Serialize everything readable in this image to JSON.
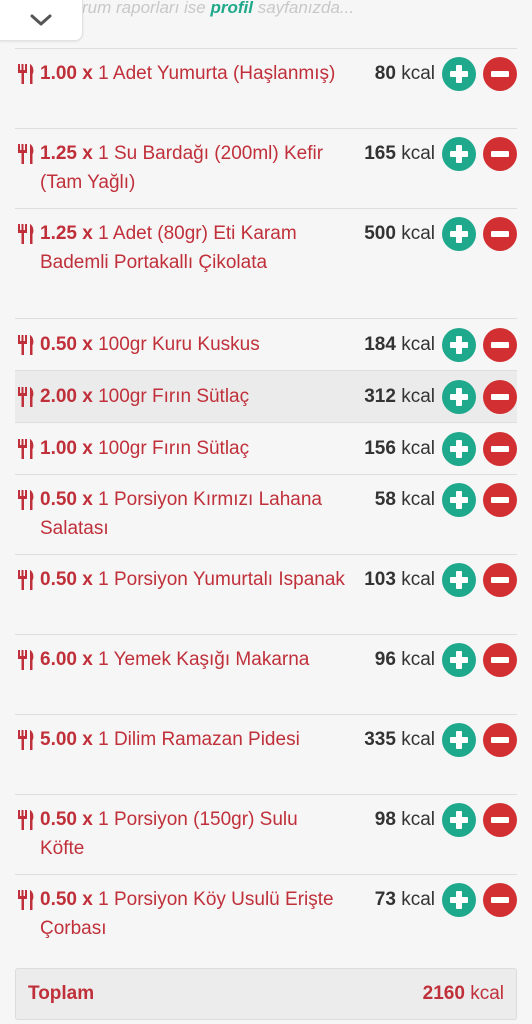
{
  "header": {
    "hint_prefix": "rum raporları ise ",
    "hint_link": "profil",
    "hint_suffix": " sayfanızda...",
    "toggle_icon": "chevron-down-icon"
  },
  "colors": {
    "accent_red": "#c0303a",
    "plus_green": "#1ea88c",
    "minus_red": "#d22f33"
  },
  "kcal_unit": "kcal",
  "items": [
    {
      "qty": "1.00 x",
      "food": "1 Adet Yumurta (Haşlanmış)",
      "kcal": "80",
      "lines": 2
    },
    {
      "qty": "1.25 x",
      "food": "1 Su Bardağı (200ml) Kefir (Tam Yağlı)",
      "kcal": "165",
      "lines": 2
    },
    {
      "qty": "1.25 x",
      "food": "1 Adet (80gr) Eti Karam Bademli Portakallı Çikolata",
      "kcal": "500",
      "lines": 3
    },
    {
      "qty": "0.50 x",
      "food": "100gr Kuru Kuskus",
      "kcal": "184",
      "lines": 1
    },
    {
      "qty": "2.00 x",
      "food": "100gr Fırın Sütlaç",
      "kcal": "312",
      "lines": 1,
      "highlighted": true
    },
    {
      "qty": "1.00 x",
      "food": "100gr Fırın Sütlaç",
      "kcal": "156",
      "lines": 1
    },
    {
      "qty": "0.50 x",
      "food": "1 Porsiyon Kırmızı Lahana Salatası",
      "kcal": "58",
      "lines": 2
    },
    {
      "qty": "0.50 x",
      "food": "1 Porsiyon Yumurtalı Ispanak",
      "kcal": "103",
      "lines": 2
    },
    {
      "qty": "6.00 x",
      "food": "1 Yemek Kaşığı Makarna",
      "kcal": "96",
      "lines": 2
    },
    {
      "qty": "5.00 x",
      "food": "1 Dilim Ramazan Pidesi",
      "kcal": "335",
      "lines": 2
    },
    {
      "qty": "0.50 x",
      "food": "1 Porsiyon (150gr) Sulu Köfte",
      "kcal": "98",
      "lines": 2
    },
    {
      "qty": "0.50 x",
      "food": "1 Porsiyon Köy Usulü Erişte Çorbası",
      "kcal": "73",
      "lines": 2
    }
  ],
  "total": {
    "label": "Toplam",
    "value": "2160",
    "unit": "kcal"
  }
}
